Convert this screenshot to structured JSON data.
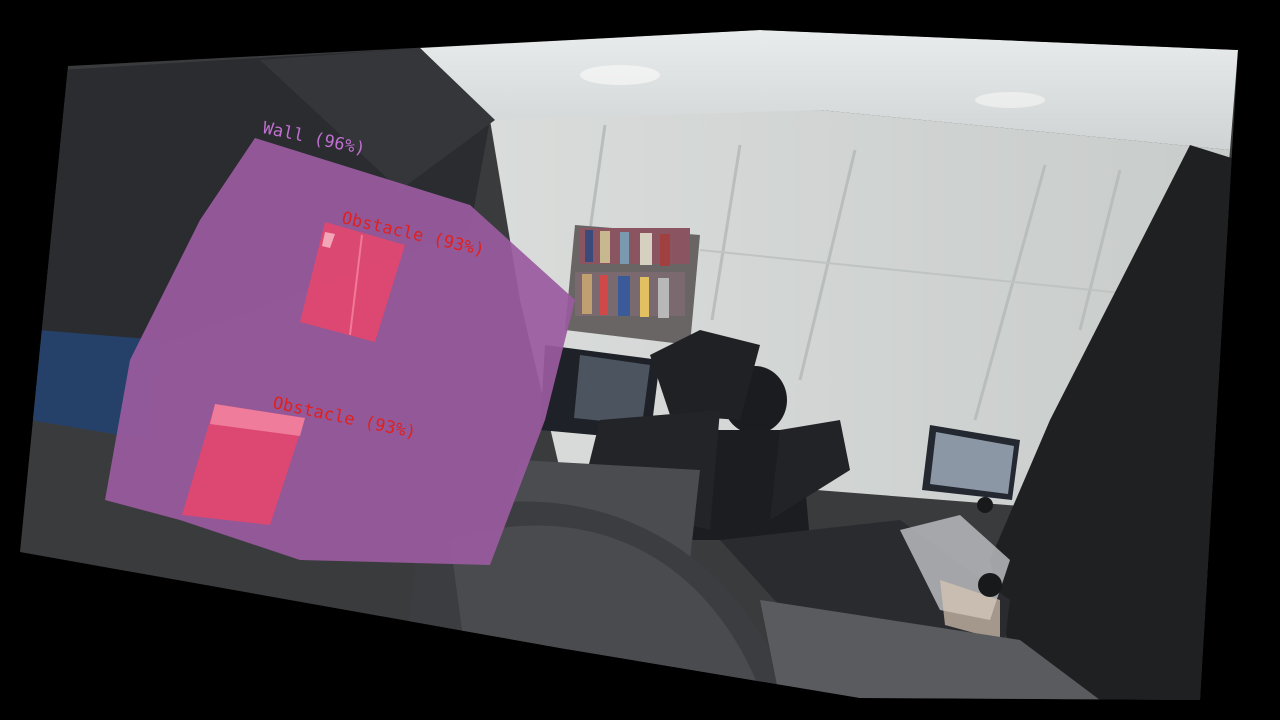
{
  "image_type": "segmentation-overlay-photo",
  "detections": [
    {
      "id": "wall",
      "label": "Wall (96%)",
      "class": "Wall",
      "confidence": 0.96,
      "color": "#c070d0"
    },
    {
      "id": "obstacle-1",
      "label": "Obstacle (93%)",
      "class": "Obstacle",
      "confidence": 0.93,
      "color": "#e0201f"
    },
    {
      "id": "obstacle-2",
      "label": "Obstacle (93%)",
      "class": "Obstacle",
      "confidence": 0.93,
      "color": "#e0201f"
    }
  ],
  "colors": {
    "wall_fill": "#9a5a9e",
    "obstacle_fill": "#e2466e",
    "obstacle_label": "#e0201f",
    "wall_label": "#c070d0",
    "background": "#000000"
  }
}
